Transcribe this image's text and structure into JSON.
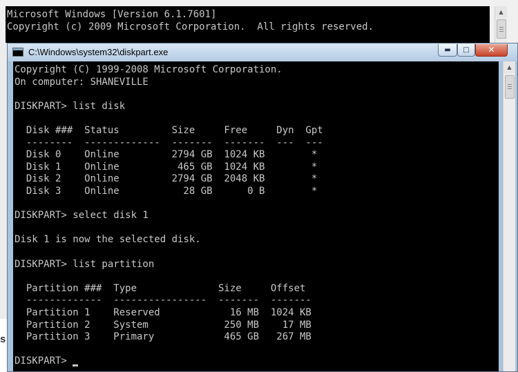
{
  "background_console": {
    "lines": [
      "Microsoft Windows [Version 6.1.7601]",
      "Copyright (c) 2009 Microsoft Corporation.  All rights reserved."
    ]
  },
  "background_fragment": "s",
  "window": {
    "title": "C:\\Windows\\system32\\diskpart.exe",
    "minimize_glyph": "▬",
    "maximize_glyph": "□",
    "close_glyph": "✕",
    "icon": "console-icon"
  },
  "console": {
    "lines": [
      "Copyright (C) 1999-2008 Microsoft Corporation.",
      "On computer: SHANEVILLE",
      "",
      "DISKPART> list disk",
      "",
      "  Disk ###  Status         Size     Free     Dyn  Gpt",
      "  --------  -------------  -------  -------  ---  ---",
      "  Disk 0    Online         2794 GB  1024 KB        *",
      "  Disk 1    Online          465 GB  1024 KB        *",
      "  Disk 2    Online         2794 GB  2048 KB        *",
      "  Disk 3    Online           28 GB      0 B        *",
      "",
      "DISKPART> select disk 1",
      "",
      "Disk 1 is now the selected disk.",
      "",
      "DISKPART> list partition",
      "",
      "  Partition ###  Type              Size     Offset",
      "  -------------  ----------------  -------  -------",
      "  Partition 1    Reserved            16 MB  1024 KB",
      "  Partition 2    System             250 MB    17 MB",
      "  Partition 3    Primary            465 GB   267 MB",
      "",
      "DISKPART> "
    ]
  },
  "scrollbar": {
    "up_glyph": "▲",
    "down_glyph": "▼"
  }
}
